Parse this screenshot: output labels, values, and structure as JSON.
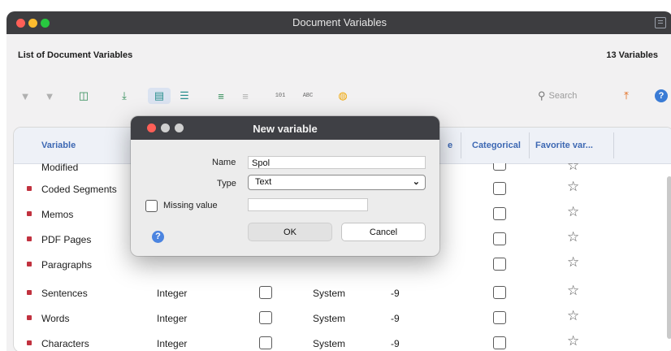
{
  "window": {
    "title": "Document Variables"
  },
  "header": {
    "list_title": "List of Document Variables",
    "count": "13 Variables"
  },
  "toolbar": {
    "search_placeholder": "Search",
    "icons": {
      "filter": "▼",
      "filter2": "▼",
      "columns": "◫",
      "download": "⤓",
      "doc": "▤",
      "list": "☰",
      "add": "≡",
      "remove": "≡",
      "num_label": "101",
      "abc_label": "ABC",
      "orange": "◍",
      "upload": "⤒",
      "help": "?"
    }
  },
  "table": {
    "columns": {
      "variable": "Variable",
      "missing_partial": "e",
      "categorical": "Categorical",
      "favorite": "Favorite var..."
    },
    "partial_row": {
      "name": "Modified"
    },
    "rows": [
      {
        "name": "Coded Segments",
        "type": "",
        "origin": "",
        "missing": ""
      },
      {
        "name": "Memos",
        "type": "",
        "origin": "",
        "missing": ""
      },
      {
        "name": "PDF Pages",
        "type": "",
        "origin": "",
        "missing": ""
      },
      {
        "name": "Paragraphs",
        "type": "",
        "origin": "",
        "missing": ""
      },
      {
        "name": "Sentences",
        "type": "Integer",
        "origin": "System",
        "missing": "-9"
      },
      {
        "name": "Words",
        "type": "Integer",
        "origin": "System",
        "missing": "-9"
      },
      {
        "name": "Characters",
        "type": "Integer",
        "origin": "System",
        "missing": "-9"
      }
    ],
    "star_glyph": "☆"
  },
  "dialog": {
    "title": "New variable",
    "name_label": "Name",
    "name_value": "Spol",
    "type_label": "Type",
    "type_value": "Text",
    "missing_label": "Missing value",
    "missing_value": "",
    "ok_label": "OK",
    "cancel_label": "Cancel",
    "help_glyph": "?",
    "chevron": "⌄"
  },
  "colors": {
    "accent": "#3d68b3",
    "marker": "#c1323f",
    "titlebar": "#3d3d40"
  }
}
